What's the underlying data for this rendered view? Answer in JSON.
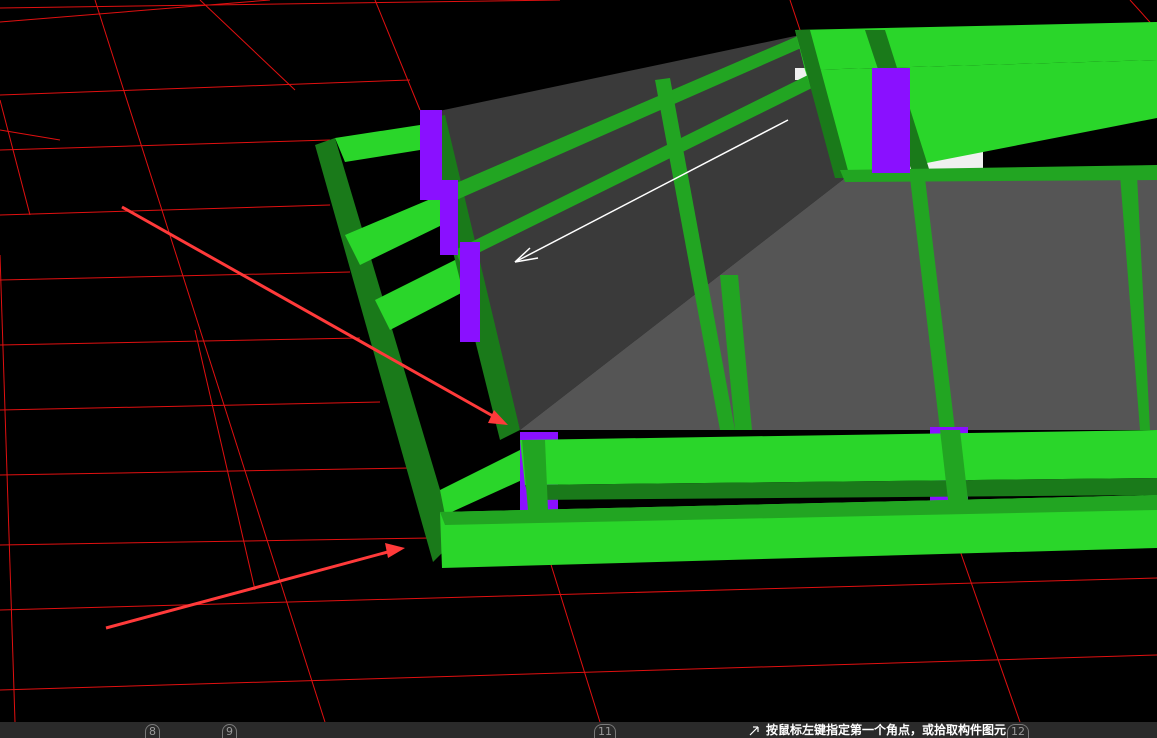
{
  "viewport": {
    "background": "#000000",
    "grid_color": "#e01010",
    "colors": {
      "beam_green": "#2ad62a",
      "beam_green_dark": "#1a7a1a",
      "column_purple": "#8a10ff",
      "slab_gray": "#4a4a4a",
      "slab_dark": "#3a3a3a",
      "white_panel": "#f0f0f0",
      "arrow_red": "#ff3a3a",
      "arrow_white": "#ffffff"
    },
    "icons": [
      "red-pointer-arrow",
      "white-direction-arrow"
    ]
  },
  "status_bar": {
    "axis_labels": [
      "8",
      "9",
      "11",
      "12"
    ],
    "prompt": "按鼠标左键指定第一个角点，或拾取构件图元",
    "icon": "crosshair-cursor-icon"
  }
}
